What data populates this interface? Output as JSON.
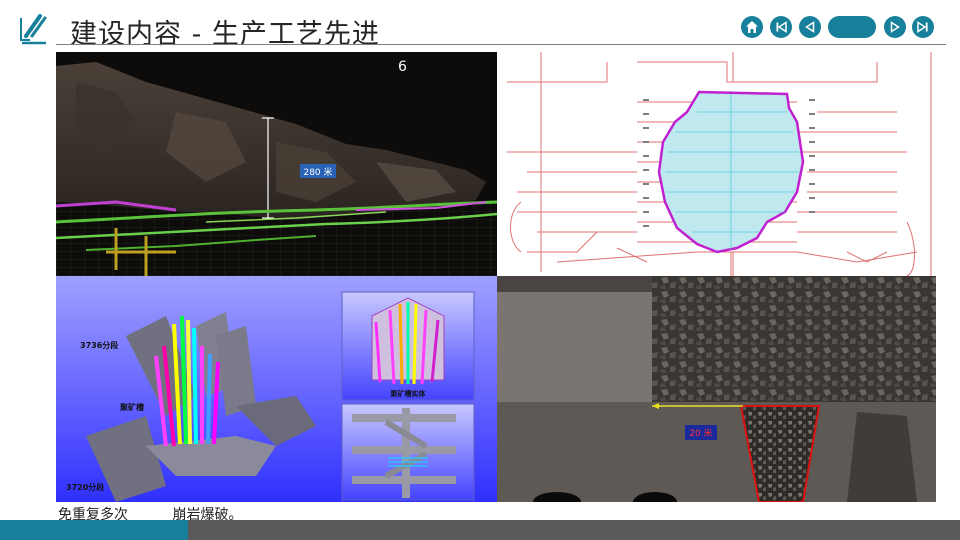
{
  "header": {
    "title": "建设内容 - 生产工艺先进"
  },
  "nav": {
    "home_icon": "home-icon",
    "first_icon": "skip-first-icon",
    "prev_icon": "prev-icon",
    "next_icon": "next-icon",
    "last_icon": "skip-last-icon",
    "accent_color": "#17809a"
  },
  "slide": {
    "page_number": "6"
  },
  "figures": {
    "orebody_height_label": "280 米",
    "section_upper_label": "3736分段",
    "section_lower_label": "3720分段",
    "chute_label": "聚矿槽",
    "chute_body_label": "聚矿槽实体",
    "draw_width_label": "20 米"
  },
  "caption": {
    "text": "免重复多次          崩岩爆破。"
  },
  "footer": {
    "left_color": "#17809a",
    "right_color": "#595959"
  }
}
